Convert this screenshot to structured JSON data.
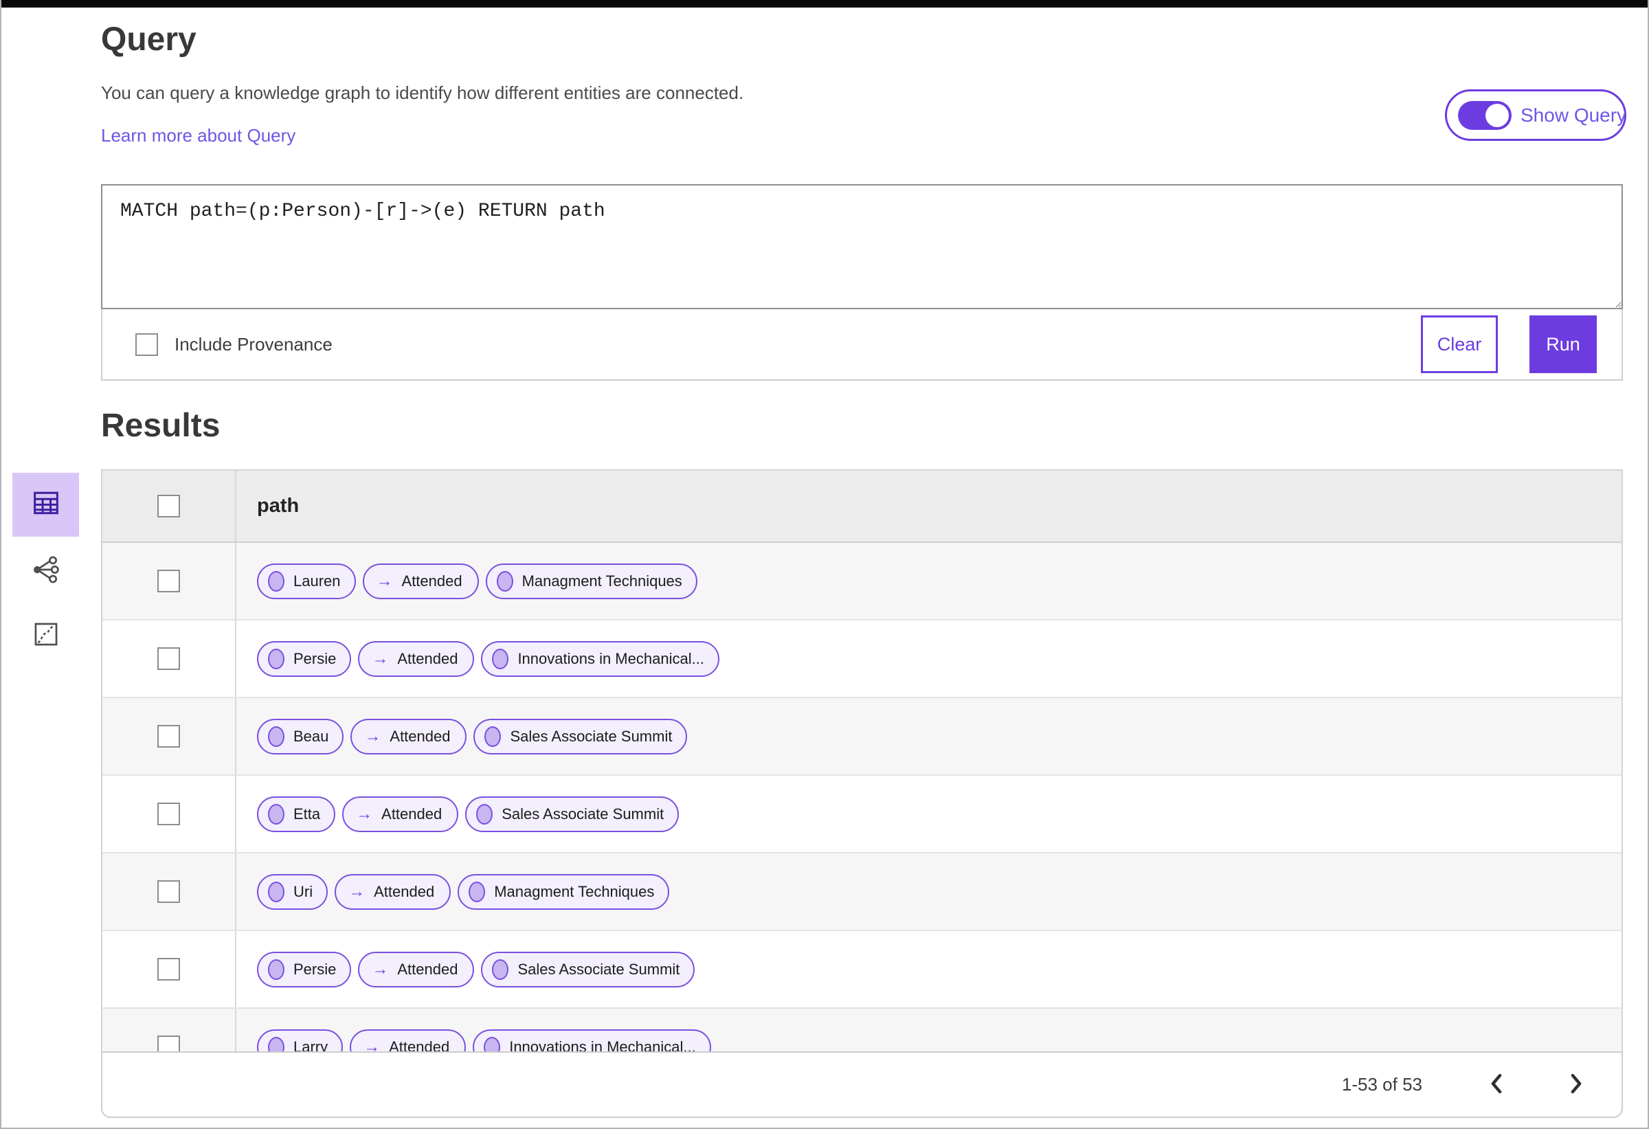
{
  "page": {
    "query": {
      "title": "Query",
      "description": "You can query a knowledge graph to identify how different entities are connected.",
      "learn_more": "Learn more about Query",
      "show_query": "Show Query",
      "code": "MATCH path=(p:Person)-[r]->(e) RETURN path",
      "include_provenance": "Include Provenance",
      "clear": "Clear",
      "run": "Run"
    },
    "results": {
      "title": "Results",
      "views": [
        {
          "name": "table-view",
          "selected": true
        },
        {
          "name": "graph-view",
          "selected": false
        },
        {
          "name": "chart-view",
          "selected": false
        }
      ],
      "table": {
        "header": "path",
        "relation_arrow": "→",
        "rows": [
          {
            "source": "Lauren",
            "relation": "Attended",
            "target": "Managment Techniques"
          },
          {
            "source": "Persie",
            "relation": "Attended",
            "target": "Innovations in Mechanical..."
          },
          {
            "source": "Beau",
            "relation": "Attended",
            "target": "Sales Associate Summit"
          },
          {
            "source": "Etta",
            "relation": "Attended",
            "target": "Sales Associate Summit"
          },
          {
            "source": "Uri",
            "relation": "Attended",
            "target": "Managment Techniques"
          },
          {
            "source": "Persie",
            "relation": "Attended",
            "target": "Sales Associate Summit"
          },
          {
            "source": "Larry",
            "relation": "Attended",
            "target": "Innovations in Mechanical..."
          }
        ]
      },
      "pagination": {
        "range": "1-53 of 53"
      }
    },
    "colors": {
      "accent": "#6c3ce0",
      "link": "#6e56e6",
      "chip_border": "#7a50e0",
      "chip_bg": "#f3effc",
      "chip_circle": "#c9b6f0",
      "selected_view_bg": "#d8c6f7",
      "selected_view_icon": "#3c1f9e"
    }
  }
}
